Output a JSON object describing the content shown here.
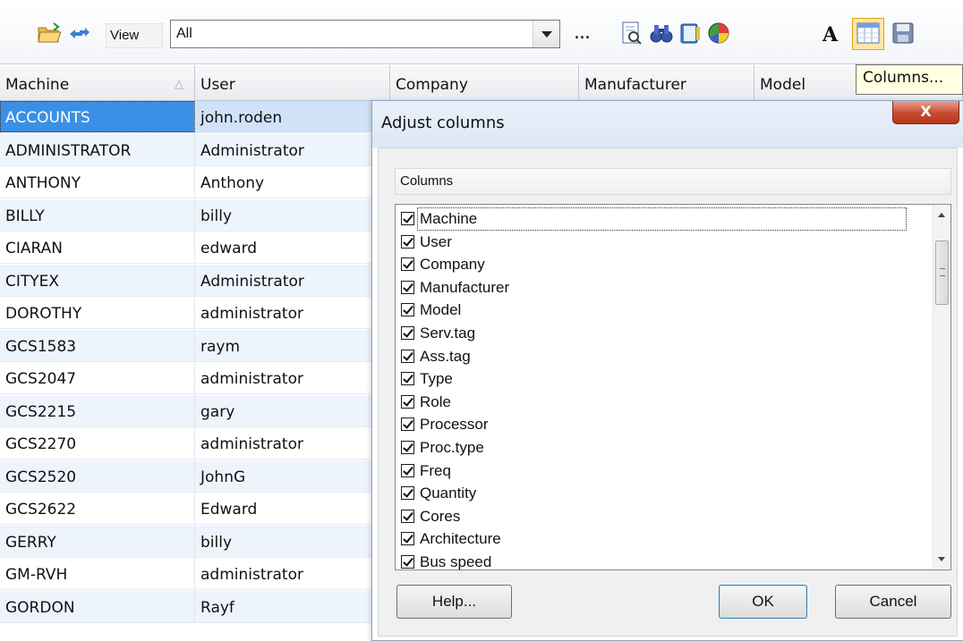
{
  "toolbar": {
    "view_label": "View",
    "view_value": "All",
    "more_label": "...",
    "tooltip": "Columns..."
  },
  "grid": {
    "headers": {
      "machine": "Machine",
      "user": "User",
      "company": "Company",
      "manufacturer": "Manufacturer",
      "model": "Model"
    },
    "rows": [
      {
        "machine": "ACCOUNTS",
        "user": "john.roden"
      },
      {
        "machine": "ADMINISTRATOR",
        "user": "Administrator"
      },
      {
        "machine": "ANTHONY",
        "user": "Anthony"
      },
      {
        "machine": "BILLY",
        "user": "billy"
      },
      {
        "machine": "CIARAN",
        "user": "edward"
      },
      {
        "machine": "CITYEX",
        "user": "Administrator"
      },
      {
        "machine": "DOROTHY",
        "user": "administrator"
      },
      {
        "machine": "GCS1583",
        "user": "raym"
      },
      {
        "machine": "GCS2047",
        "user": "administrator"
      },
      {
        "machine": "GCS2215",
        "user": "gary"
      },
      {
        "machine": "GCS2270",
        "user": "administrator"
      },
      {
        "machine": "GCS2520",
        "user": "JohnG"
      },
      {
        "machine": "GCS2622",
        "user": "Edward"
      },
      {
        "machine": "GERRY",
        "user": "billy"
      },
      {
        "machine": "GM-RVH",
        "user": "administrator"
      },
      {
        "machine": "GORDON",
        "user": "Rayf"
      }
    ]
  },
  "dialog": {
    "title": "Adjust columns",
    "close_label": "X",
    "columns_header": "Columns",
    "columns": [
      {
        "label": "Machine",
        "checked": true
      },
      {
        "label": "User",
        "checked": true
      },
      {
        "label": "Company",
        "checked": true
      },
      {
        "label": "Manufacturer",
        "checked": true
      },
      {
        "label": "Model",
        "checked": true
      },
      {
        "label": "Serv.tag",
        "checked": true
      },
      {
        "label": "Ass.tag",
        "checked": true
      },
      {
        "label": "Type",
        "checked": true
      },
      {
        "label": "Role",
        "checked": true
      },
      {
        "label": "Processor",
        "checked": true
      },
      {
        "label": "Proc.type",
        "checked": true
      },
      {
        "label": "Freq",
        "checked": true
      },
      {
        "label": "Quantity",
        "checked": true
      },
      {
        "label": "Cores",
        "checked": true
      },
      {
        "label": "Architecture",
        "checked": true
      },
      {
        "label": "Bus speed",
        "checked": true
      }
    ],
    "help_label": "Help...",
    "ok_label": "OK",
    "cancel_label": "Cancel"
  }
}
